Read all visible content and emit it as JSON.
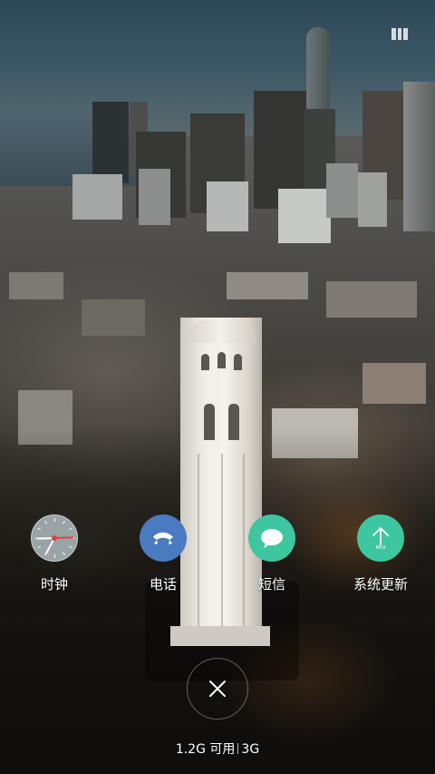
{
  "shortcuts": [
    {
      "label": "时钟",
      "icon": "clock-icon",
      "color": "#9aa3a6"
    },
    {
      "label": "电话",
      "icon": "phone-icon",
      "color": "#4a7bc0"
    },
    {
      "label": "短信",
      "icon": "message-icon",
      "color": "#3ec6a0"
    },
    {
      "label": "系统更新",
      "icon": "system-update-icon",
      "color": "#3ec6a0",
      "badge": "MIUI"
    }
  ],
  "memory": {
    "available": "1.2G 可用",
    "total": "3G"
  },
  "close_icon": "close-icon",
  "status_icon": "recent-apps-icon"
}
